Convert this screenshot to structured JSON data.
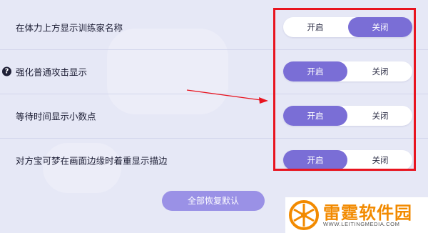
{
  "settings": {
    "rows": [
      {
        "label": "在体力上方显示训练家名称",
        "on_label": "开启",
        "off_label": "关闭",
        "selected": "off",
        "has_help": false
      },
      {
        "label": "强化普通攻击显示",
        "on_label": "开启",
        "off_label": "关闭",
        "selected": "on",
        "has_help": true
      },
      {
        "label": "等待时间显示小数点",
        "on_label": "开启",
        "off_label": "关闭",
        "selected": "on",
        "has_help": false
      },
      {
        "label": "对方宝可梦在画面边缘时着重显示描边",
        "on_label": "开启",
        "off_label": "关闭",
        "selected": "on",
        "has_help": false
      }
    ],
    "help_glyph": "?",
    "reset_label": "全部恢复默认"
  },
  "annotation": {
    "highlight_color": "#e8141f"
  },
  "watermark": {
    "title": "雷霆软件园",
    "url": "WWW.LEITINGMEDIA.COM",
    "color": "#f28a00"
  },
  "colors": {
    "accent": "#7a6ed6",
    "background": "#e6e8f6",
    "reset_button": "#9a91e6"
  }
}
